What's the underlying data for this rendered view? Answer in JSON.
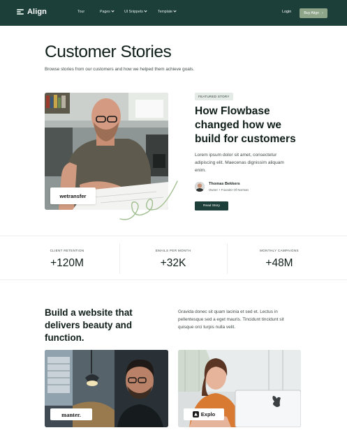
{
  "nav": {
    "brand": "Align",
    "links": [
      {
        "label": "Tour",
        "dropdown": false
      },
      {
        "label": "Pages",
        "dropdown": true
      },
      {
        "label": "UI Snippets",
        "dropdown": true
      },
      {
        "label": "Template",
        "dropdown": true
      }
    ],
    "login": "Login",
    "cta": "Buy Align",
    "cta_arrow": "›"
  },
  "hero": {
    "title": "Customer Stories",
    "subtitle": "Browse stories from our customers and how we helped them achieve goals."
  },
  "featured": {
    "tag": "FEATURED STORY",
    "title": "How Flowbase changed how we build for customers",
    "body": "Lorem ipsum dolor sit amet, consectetur adipiscing elit. Maecenas dignissim aliquam enim.",
    "author_name": "Thomas Bekkers",
    "author_role": "Owner + Founder Of Norman",
    "button": "Read Story",
    "logo": "wetransfer"
  },
  "stats": [
    {
      "label": "CLIENT RETENTION",
      "value": "+120M"
    },
    {
      "label": "EMAILS PER MONTH",
      "value": "+32K"
    },
    {
      "label": "MONTHLY CAMPAIGNS",
      "value": "+48M"
    }
  ],
  "section": {
    "title": "Build a website that delivers beauty and function.",
    "body": "Gravida donec sit quam lacinia et sed et. Lectus in pellentesque sed a eget mauris. Tincidunt tincidunt sit quisque orci turpis nulla velit."
  },
  "cards": [
    {
      "logo": "manter."
    },
    {
      "logo": "Explo"
    }
  ],
  "colors": {
    "nav_bg": "#1c3f3a",
    "cta_bg": "#8ea58a",
    "button_bg": "#1c3f3a"
  }
}
